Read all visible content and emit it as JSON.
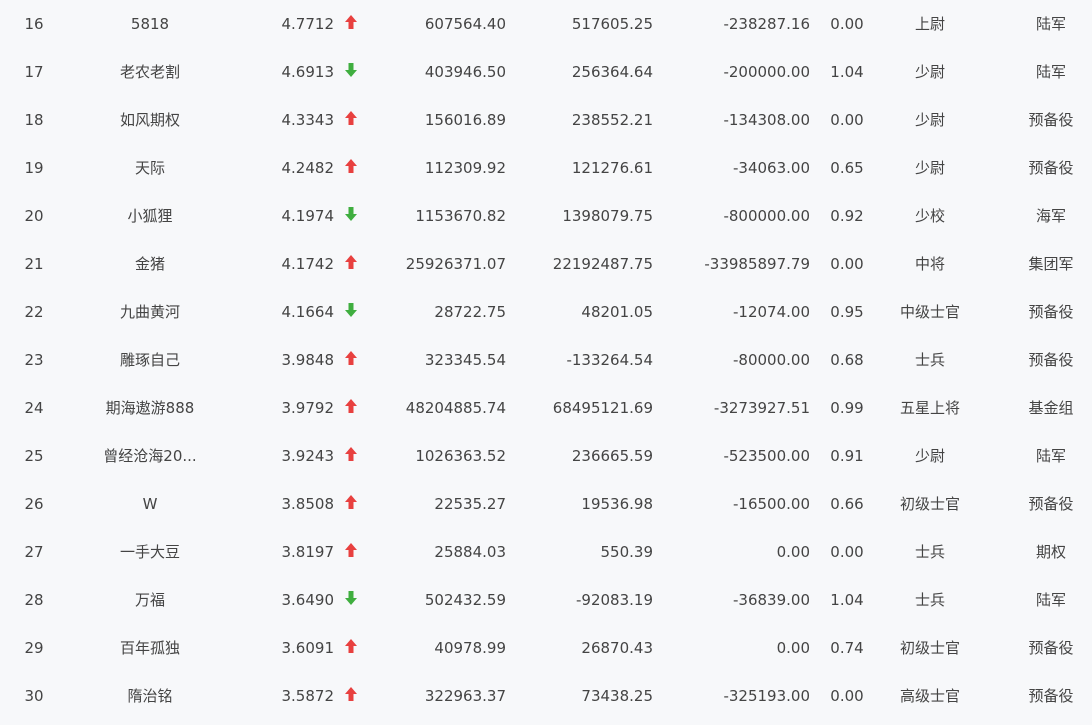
{
  "colors": {
    "up": "#e8403f",
    "down": "#3fae3f",
    "text": "#444444",
    "background": "#f7f8fa"
  },
  "rows": [
    {
      "rank": "16",
      "name": "5818",
      "score": "4.7712",
      "trend": "up",
      "trend_icon": "arrow-up-icon",
      "v1": "607564.40",
      "v2": "517605.25",
      "v3": "-238287.16",
      "ratio": "0.00",
      "rank_title": "上尉",
      "group": "陆军"
    },
    {
      "rank": "17",
      "name": "老农老割",
      "score": "4.6913",
      "trend": "down",
      "trend_icon": "arrow-down-icon",
      "v1": "403946.50",
      "v2": "256364.64",
      "v3": "-200000.00",
      "ratio": "1.04",
      "rank_title": "少尉",
      "group": "陆军"
    },
    {
      "rank": "18",
      "name": "如风期权",
      "score": "4.3343",
      "trend": "up",
      "trend_icon": "arrow-up-icon",
      "v1": "156016.89",
      "v2": "238552.21",
      "v3": "-134308.00",
      "ratio": "0.00",
      "rank_title": "少尉",
      "group": "预备役"
    },
    {
      "rank": "19",
      "name": "天际",
      "score": "4.2482",
      "trend": "up",
      "trend_icon": "arrow-up-icon",
      "v1": "112309.92",
      "v2": "121276.61",
      "v3": "-34063.00",
      "ratio": "0.65",
      "rank_title": "少尉",
      "group": "预备役"
    },
    {
      "rank": "20",
      "name": "小狐狸",
      "score": "4.1974",
      "trend": "down",
      "trend_icon": "arrow-down-icon",
      "v1": "1153670.82",
      "v2": "1398079.75",
      "v3": "-800000.00",
      "ratio": "0.92",
      "rank_title": "少校",
      "group": "海军"
    },
    {
      "rank": "21",
      "name": "金猪",
      "score": "4.1742",
      "trend": "up",
      "trend_icon": "arrow-up-icon",
      "v1": "25926371.07",
      "v2": "22192487.75",
      "v3": "-33985897.79",
      "ratio": "0.00",
      "rank_title": "中将",
      "group": "集团军"
    },
    {
      "rank": "22",
      "name": "九曲黄河",
      "score": "4.1664",
      "trend": "down",
      "trend_icon": "arrow-down-icon",
      "v1": "28722.75",
      "v2": "48201.05",
      "v3": "-12074.00",
      "ratio": "0.95",
      "rank_title": "中级士官",
      "group": "预备役"
    },
    {
      "rank": "23",
      "name": "雕琢自己",
      "score": "3.9848",
      "trend": "up",
      "trend_icon": "arrow-up-icon",
      "v1": "323345.54",
      "v2": "-133264.54",
      "v3": "-80000.00",
      "ratio": "0.68",
      "rank_title": "士兵",
      "group": "预备役"
    },
    {
      "rank": "24",
      "name": "期海遨游888",
      "score": "3.9792",
      "trend": "up",
      "trend_icon": "arrow-up-icon",
      "v1": "48204885.74",
      "v2": "68495121.69",
      "v3": "-3273927.51",
      "ratio": "0.99",
      "rank_title": "五星上将",
      "group": "基金组"
    },
    {
      "rank": "25",
      "name": "曾经沧海20...",
      "score": "3.9243",
      "trend": "up",
      "trend_icon": "arrow-up-icon",
      "v1": "1026363.52",
      "v2": "236665.59",
      "v3": "-523500.00",
      "ratio": "0.91",
      "rank_title": "少尉",
      "group": "陆军"
    },
    {
      "rank": "26",
      "name": "W",
      "score": "3.8508",
      "trend": "up",
      "trend_icon": "arrow-up-icon",
      "v1": "22535.27",
      "v2": "19536.98",
      "v3": "-16500.00",
      "ratio": "0.66",
      "rank_title": "初级士官",
      "group": "预备役"
    },
    {
      "rank": "27",
      "name": "一手大豆",
      "score": "3.8197",
      "trend": "up",
      "trend_icon": "arrow-up-icon",
      "v1": "25884.03",
      "v2": "550.39",
      "v3": "0.00",
      "ratio": "0.00",
      "rank_title": "士兵",
      "group": "期权"
    },
    {
      "rank": "28",
      "name": "万福",
      "score": "3.6490",
      "trend": "down",
      "trend_icon": "arrow-down-icon",
      "v1": "502432.59",
      "v2": "-92083.19",
      "v3": "-36839.00",
      "ratio": "1.04",
      "rank_title": "士兵",
      "group": "陆军"
    },
    {
      "rank": "29",
      "name": "百年孤独",
      "score": "3.6091",
      "trend": "up",
      "trend_icon": "arrow-up-icon",
      "v1": "40978.99",
      "v2": "26870.43",
      "v3": "0.00",
      "ratio": "0.74",
      "rank_title": "初级士官",
      "group": "预备役"
    },
    {
      "rank": "30",
      "name": "隋治铭",
      "score": "3.5872",
      "trend": "up",
      "trend_icon": "arrow-up-icon",
      "v1": "322963.37",
      "v2": "73438.25",
      "v3": "-325193.00",
      "ratio": "0.00",
      "rank_title": "高级士官",
      "group": "预备役"
    }
  ]
}
